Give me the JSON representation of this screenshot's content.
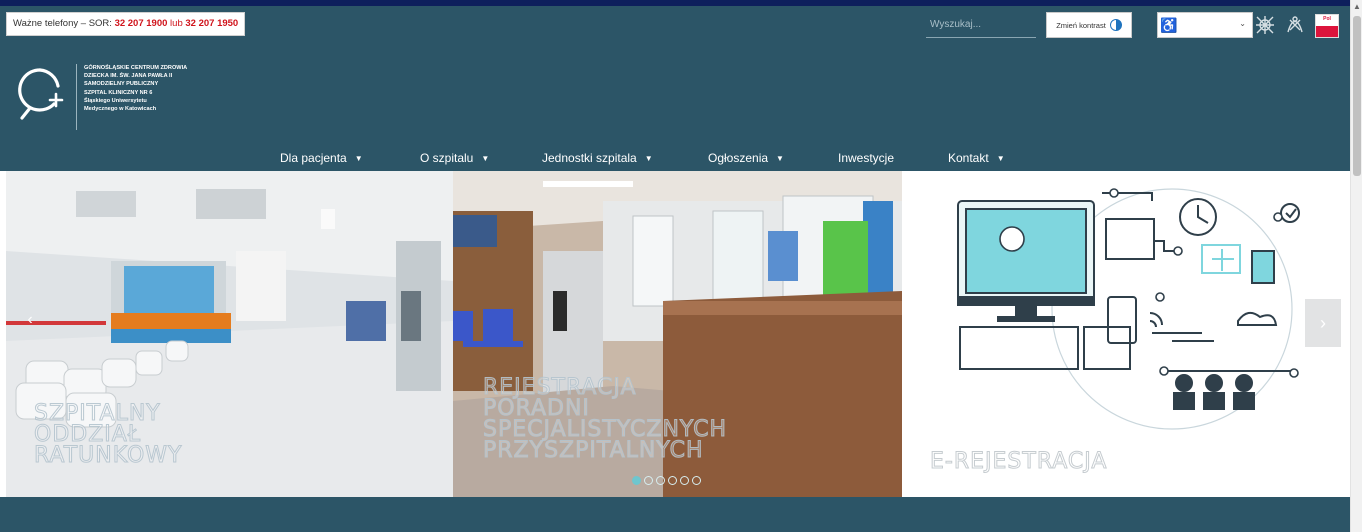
{
  "header": {
    "phone": {
      "prefix": "Ważne telefony – SOR: ",
      "num1": "32 207 1900",
      "mid": " lub ",
      "num2": "32 207 1950"
    },
    "search": {
      "placeholder": "Wyszukaj..."
    },
    "contrast": {
      "label": "Zmień kontrast"
    },
    "flag_label": "Pol"
  },
  "logo": {
    "lines": [
      "GÓRNOŚLĄSKIE CENTRUM ZDROWIA",
      "DZIECKA IM. ŚW. JANA PAWŁA II",
      "SAMODZIELNY PUBLICZNY",
      "SZPITAL KLINICZNY NR 6",
      "Śląskiego Uniwersytetu",
      "Medycznego w Katowicach"
    ]
  },
  "nav": {
    "items": [
      {
        "label": "Dla pacjenta",
        "caret": "▼"
      },
      {
        "label": "O szpitalu",
        "caret": "▼"
      },
      {
        "label": "Jednostki szpitala",
        "caret": "▼"
      },
      {
        "label": "Ogłoszenia",
        "caret": "▼"
      },
      {
        "label": "Inwestycje",
        "caret": ""
      },
      {
        "label": "Kontakt",
        "caret": "▼"
      }
    ]
  },
  "carousel": {
    "slides": [
      {
        "caption": [
          "SZPITALNY",
          "ODDZIAŁ",
          "RATUNKOWY"
        ]
      },
      {
        "caption": [
          "REJESTRACJA",
          "PORADNI",
          "SPECJALISTYCZNYCH",
          "PRZYSZPITALNYCH"
        ]
      },
      {
        "caption": [
          "E-REJESTRACJA"
        ]
      }
    ],
    "prev": "‹",
    "next": "›",
    "dot_count": 6,
    "active_dot": 0
  },
  "colors": {
    "header_bg": "#2c5567",
    "top_strip": "#0e1f5c",
    "phone_red": "#d0131b",
    "accent_teal": "#6fc6ce"
  },
  "icons": {
    "contrast": "contrast-icon",
    "accessibility": "wheelchair-icon",
    "tool1": "cross-lines-icon",
    "tool2": "pattern-icon",
    "flag": "polish-flag-icon"
  }
}
